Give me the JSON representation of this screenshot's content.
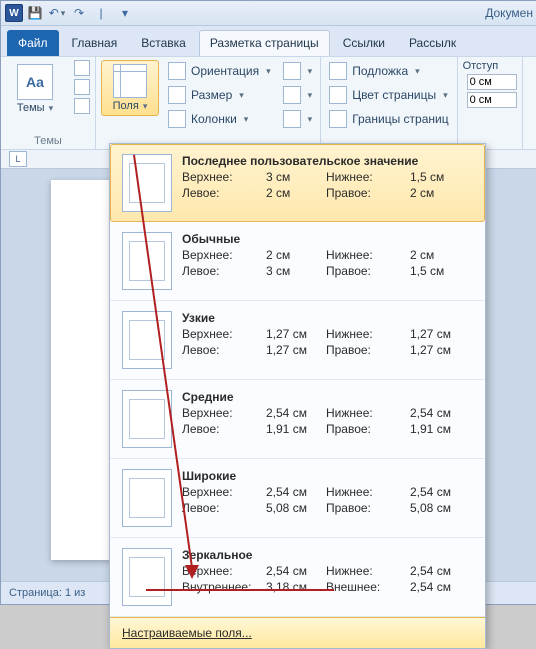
{
  "title": "Докумен",
  "tabs": {
    "file": "Файл",
    "home": "Главная",
    "insert": "Вставка",
    "layout": "Разметка страницы",
    "refs": "Ссылки",
    "mail": "Рассылк"
  },
  "ribbon": {
    "themes": {
      "btn": "Темы",
      "group": "Темы"
    },
    "margins": "Поля",
    "orientation": "Ориентация",
    "size": "Размер",
    "columns": "Колонки",
    "watermark": "Подложка",
    "pagecolor": "Цвет страницы",
    "borders": "Границы страниц",
    "indent": "Отступ",
    "left": "0 см",
    "right": "0 см"
  },
  "ruler": {
    "corner": "L"
  },
  "presets": [
    {
      "id": "last",
      "name": "Последнее пользовательское значение",
      "top": "3 см",
      "left": "2 см",
      "bottom": "1,5 см",
      "right": "2 см"
    },
    {
      "id": "normal",
      "name": "Обычные",
      "top": "2 см",
      "left": "3 см",
      "bottom": "2 см",
      "right": "1,5 см"
    },
    {
      "id": "narrow",
      "name": "Узкие",
      "top": "1,27 см",
      "left": "1,27 см",
      "bottom": "1,27 см",
      "right": "1,27 см"
    },
    {
      "id": "moderate",
      "name": "Средние",
      "top": "2,54 см",
      "left": "1,91 см",
      "bottom": "2,54 см",
      "right": "1,91 см"
    },
    {
      "id": "wide",
      "name": "Широкие",
      "top": "2,54 см",
      "left": "5,08 см",
      "bottom": "2,54 см",
      "right": "5,08 см"
    },
    {
      "id": "mirror",
      "name": "Зеркальное",
      "topk": "Верхнее:",
      "top": "2,54 см",
      "leftk": "Внутреннее:",
      "left": "3,18 см",
      "botk": "Нижнее:",
      "bottom": "2,54 см",
      "rightk": "Внешнее:",
      "right": "2,54 см"
    }
  ],
  "lbl": {
    "top": "Верхнее:",
    "left": "Левое:",
    "bottom": "Нижнее:",
    "right": "Правое:"
  },
  "custom": "Настраиваемые поля...",
  "status": "Страница: 1 из"
}
